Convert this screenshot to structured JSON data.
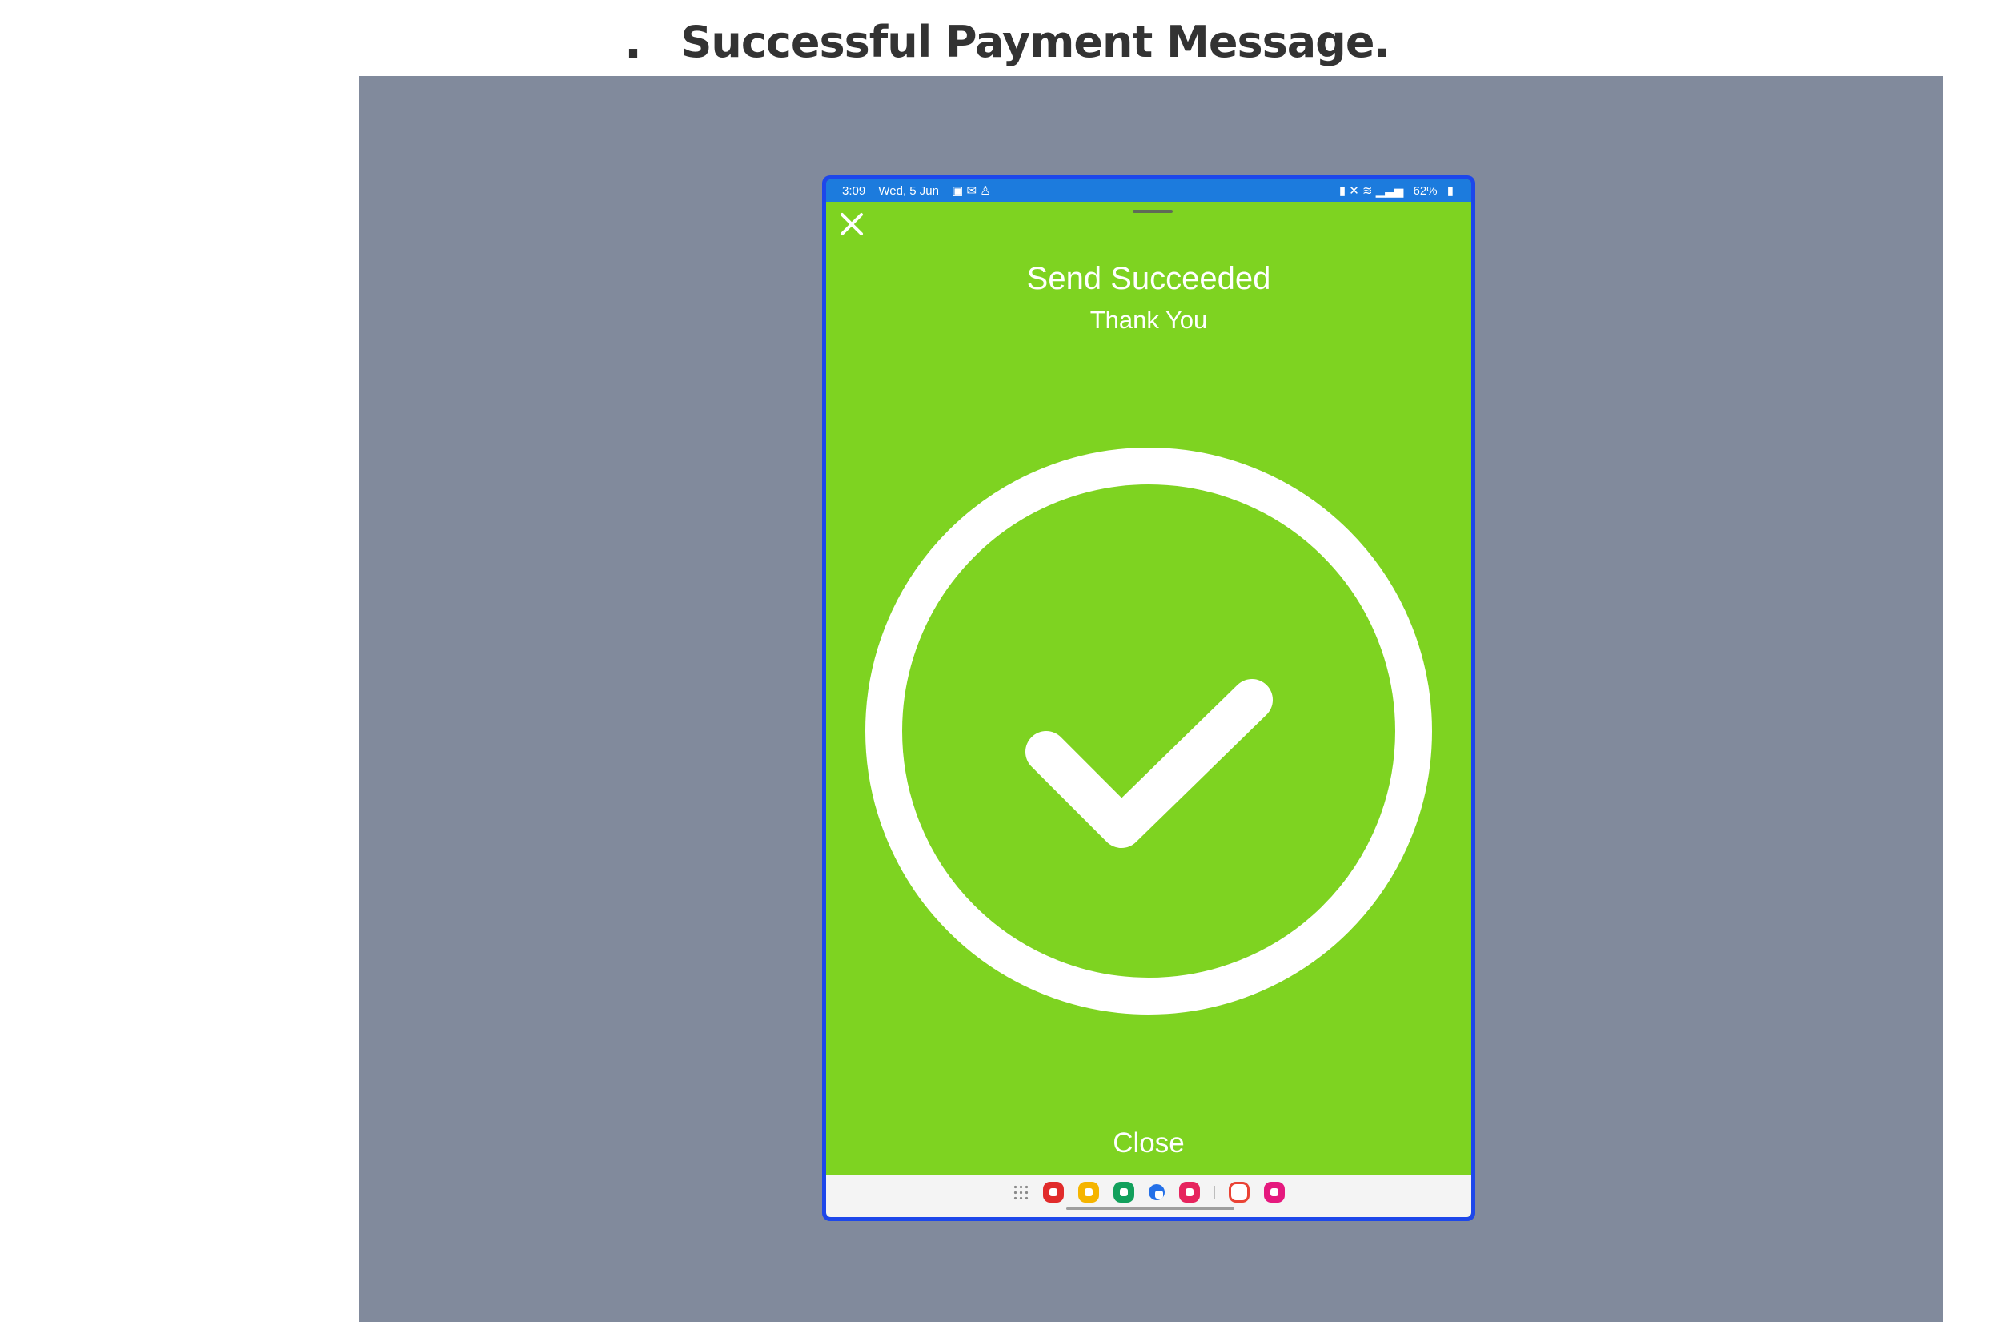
{
  "heading": {
    "bullet": ".",
    "title": "Successful Payment Message."
  },
  "device": {
    "status_bar": {
      "time": "3:09",
      "date": "Wed, 5 Jun",
      "battery": "62%"
    },
    "send_title": "Send Succeeded",
    "send_subtitle": "Thank You",
    "close_label": "Close",
    "dock_apps": [
      "apps-grid",
      "flipboard",
      "notes",
      "phone",
      "messages",
      "screen-recorder",
      "gmail",
      "gallery"
    ]
  },
  "colors": {
    "backdrop": "#818a9c",
    "device_frame": "#1d47ea",
    "status_bar": "#1c7bdd",
    "success_green": "#7ed321",
    "white": "#ffffff"
  }
}
